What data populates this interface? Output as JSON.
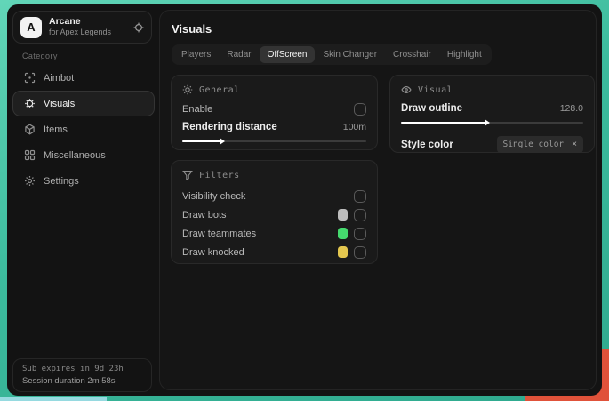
{
  "app": {
    "logo_letter": "A",
    "name": "Arcane",
    "subtitle": "for Apex Legends"
  },
  "sidebar": {
    "category_label": "Category",
    "items": [
      {
        "label": "Aimbot"
      },
      {
        "label": "Visuals"
      },
      {
        "label": "Items"
      },
      {
        "label": "Miscellaneous"
      },
      {
        "label": "Settings"
      }
    ],
    "footer": {
      "sub_expires": "Sub expires in 9d 23h",
      "session_duration": "Session duration 2m 58s"
    }
  },
  "header": {
    "title": "Visuals"
  },
  "tabs": [
    {
      "label": "Players"
    },
    {
      "label": "Radar"
    },
    {
      "label": "OffScreen"
    },
    {
      "label": "Skin Changer"
    },
    {
      "label": "Crosshair"
    },
    {
      "label": "Highlight"
    }
  ],
  "panels": {
    "general": {
      "title": "General",
      "enable_label": "Enable",
      "enable_checked": false,
      "rendering_distance_label": "Rendering distance",
      "rendering_distance_value": "100m",
      "rendering_distance_percent": 22
    },
    "visual": {
      "title": "Visual",
      "draw_outline_label": "Draw outline",
      "draw_outline_value": "128.0",
      "draw_outline_percent": 48,
      "style_color_label": "Style color",
      "style_color_value": "Single color",
      "style_color_clear": "×"
    },
    "filters": {
      "title": "Filters",
      "rows": [
        {
          "label": "Visibility check",
          "checked": false,
          "swatch": null
        },
        {
          "label": "Draw bots",
          "checked": false,
          "swatch": "#bdbdbd"
        },
        {
          "label": "Draw teammates",
          "checked": false,
          "swatch": "#45d96e"
        },
        {
          "label": "Draw knocked",
          "checked": false,
          "swatch": "#e4c74f"
        }
      ]
    }
  },
  "colors": {
    "wallpaper_teal": "#3cbb9d",
    "wallpaper_orange": "#e0523a",
    "swatch_gray": "#bdbdbd",
    "swatch_green": "#45d96e",
    "swatch_yellow": "#e4c74f"
  }
}
